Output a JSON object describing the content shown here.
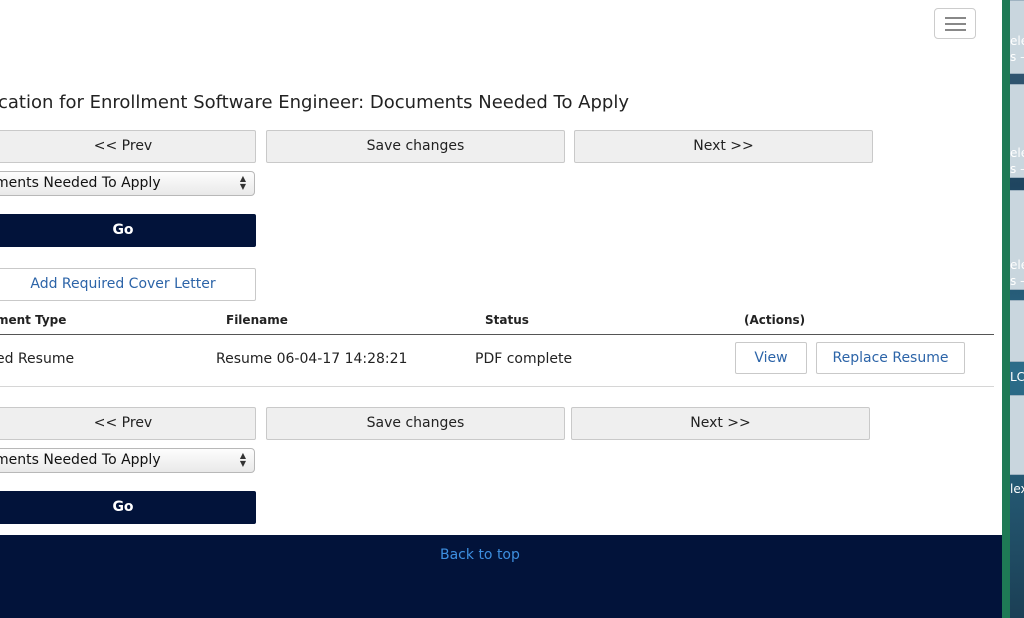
{
  "nav": {
    "menu_icon": "hamburger-menu-icon"
  },
  "page": {
    "title": "cation for Enrollment Software Engineer: Documents Needed To Apply"
  },
  "pager_top": {
    "prev": "<< Prev",
    "save": "Save changes",
    "next": "Next >>"
  },
  "section_select": {
    "value": "ments Needed To Apply",
    "go": "Go"
  },
  "add_cover_letter": "Add Required Cover Letter",
  "table": {
    "headers": [
      "ment Type",
      "Filename",
      "Status",
      "(Actions)"
    ],
    "rows": [
      {
        "type": "ed Resume",
        "filename": "Resume 06-04-17 14:28:21",
        "status": "PDF complete",
        "actions": [
          "View",
          "Replace Resume"
        ]
      }
    ]
  },
  "pager_bottom": {
    "prev": "<< Prev",
    "save": "Save changes",
    "next": "Next >>"
  },
  "section_select_bottom": {
    "value": "ments Needed To Apply",
    "go": "Go"
  },
  "footer": {
    "back_to_top": "Back to top"
  },
  "desktop_fragments": [
    "ele",
    "s –",
    "ele",
    "s –",
    "ele",
    "s –",
    "LC",
    "lex"
  ],
  "colors": {
    "navy": "#02133a",
    "link": "#2c64a8",
    "footer_link": "#3d8fe0"
  }
}
